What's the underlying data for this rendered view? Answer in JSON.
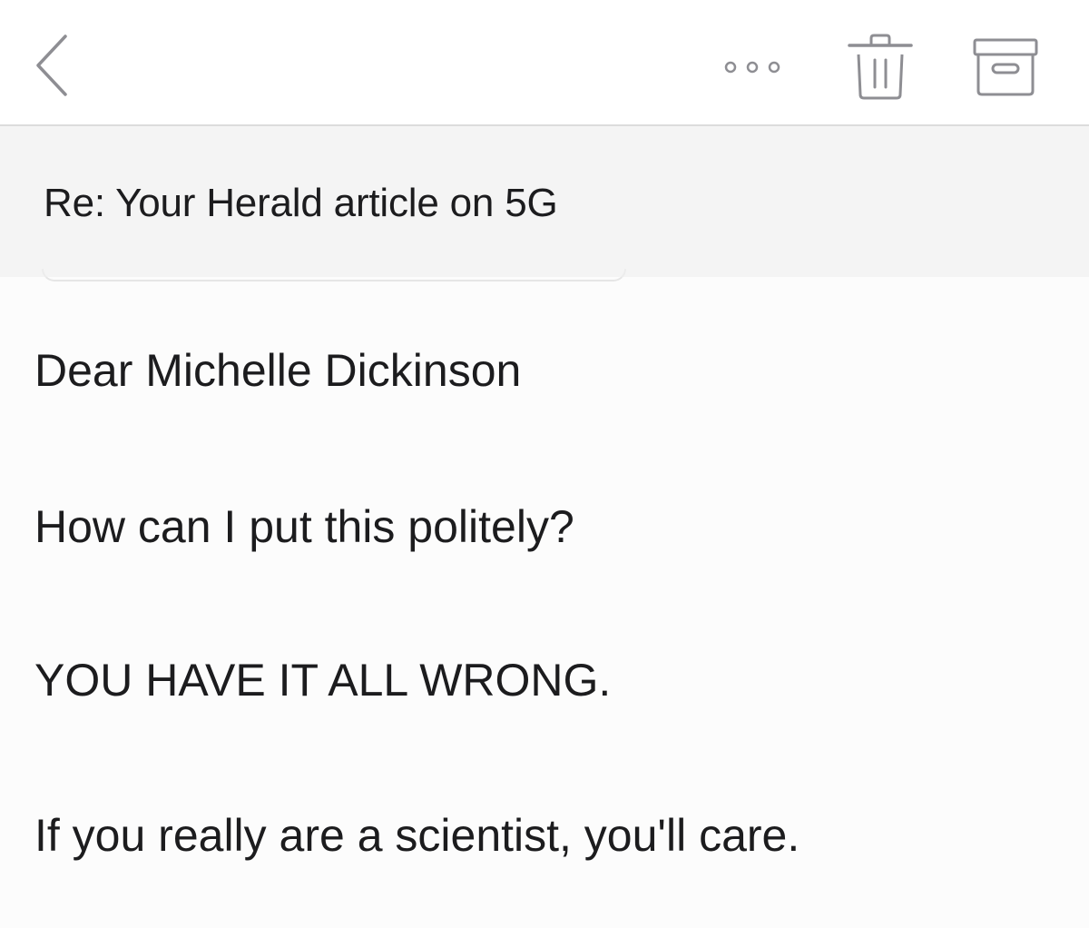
{
  "toolbar": {
    "back_icon": "chevron-left-icon",
    "more_icon": "ellipsis-icon",
    "trash_icon": "trash-icon",
    "archive_icon": "archive-box-icon",
    "icon_color": "#8e8e93"
  },
  "message": {
    "subject": "Re: Your Herald article on 5G",
    "body": [
      "Dear Michelle Dickinson",
      "How can I put this politely?",
      "YOU HAVE IT ALL WRONG.",
      "If you really are a scientist, you'll care."
    ]
  },
  "colors": {
    "toolbar_bg": "#ffffff",
    "subject_bg": "#f4f4f4",
    "body_bg": "#fcfcfc",
    "text": "#1c1c1e"
  }
}
